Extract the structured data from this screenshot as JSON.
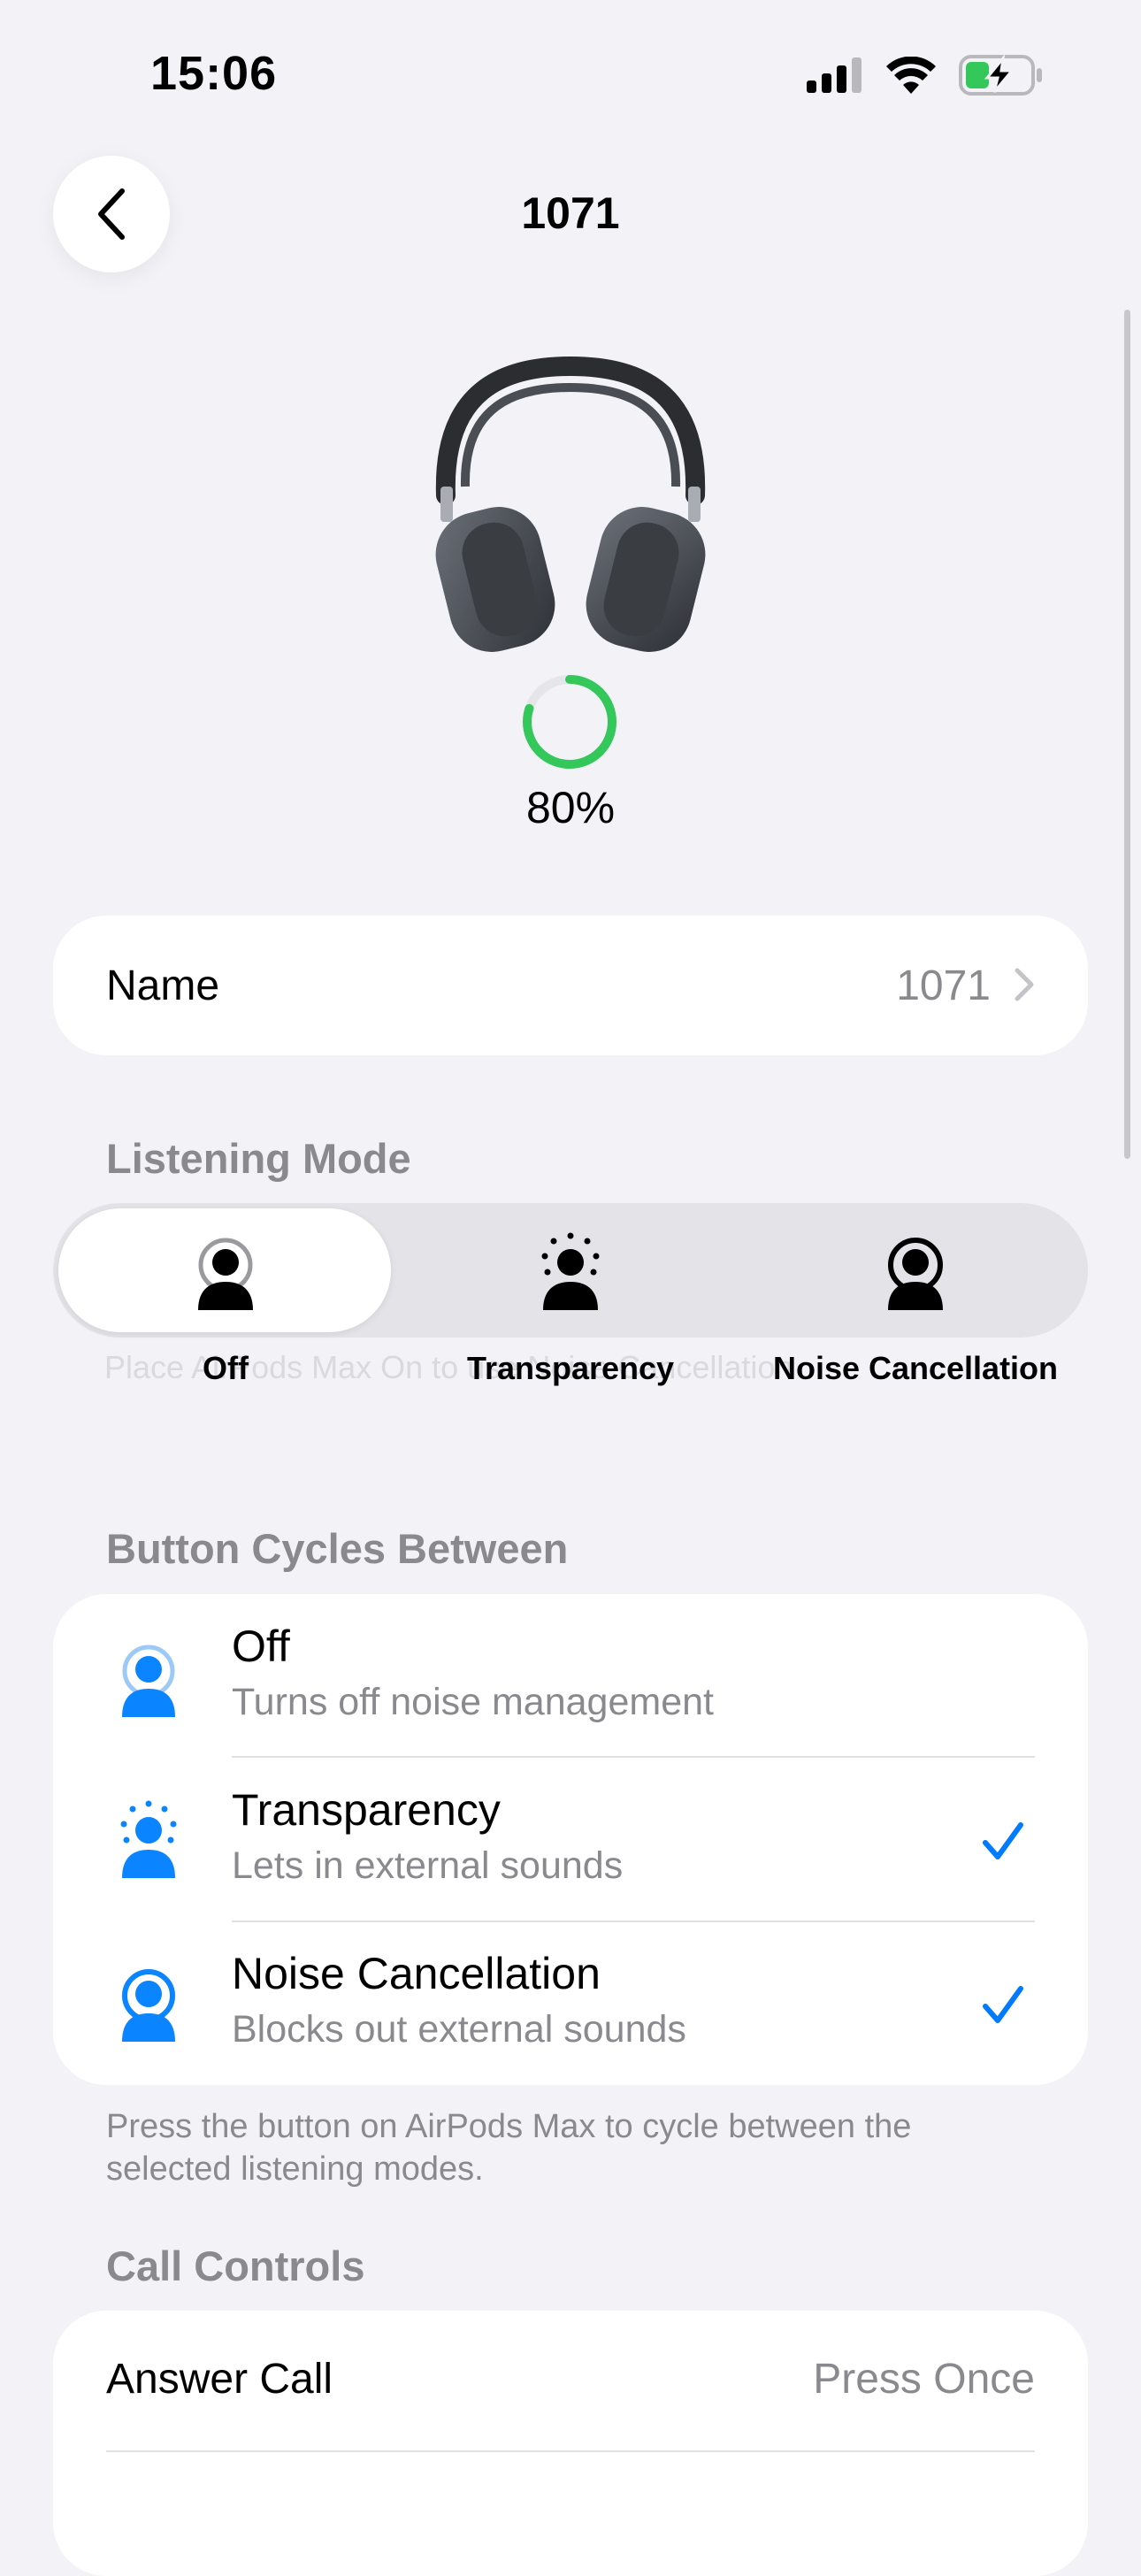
{
  "status_bar": {
    "time": "15:06"
  },
  "nav": {
    "title": "1071",
    "back_icon": "chevron-left-icon"
  },
  "device": {
    "battery_text": "80%",
    "battery_fraction": 0.8,
    "ring_color": "#34C759"
  },
  "name_row": {
    "label": "Name",
    "value": "1071"
  },
  "listening_mode": {
    "header": "Listening Mode",
    "segments": [
      {
        "label": "Off",
        "selected": true
      },
      {
        "label": "Transparency",
        "selected": false
      },
      {
        "label": "Noise Cancellation",
        "selected": false
      }
    ],
    "underlying_text": "Place AirPods Max On to use Noise Cancellation"
  },
  "button_cycles": {
    "header": "Button Cycles Between",
    "options": [
      {
        "title": "Off",
        "subtitle": "Turns off noise management",
        "checked": false
      },
      {
        "title": "Transparency",
        "subtitle": "Lets in external sounds",
        "checked": true
      },
      {
        "title": "Noise Cancellation",
        "subtitle": "Blocks out external sounds",
        "checked": true
      }
    ],
    "footnote": "Press the button on AirPods Max to cycle between the selected listening modes."
  },
  "call_controls": {
    "header": "Call Controls",
    "rows": [
      {
        "label": "Answer Call",
        "value": "Press Once"
      }
    ]
  },
  "colors": {
    "accent": "#007AFF",
    "background": "#F2F2F7",
    "secondary_text": "#8A8A8E"
  }
}
